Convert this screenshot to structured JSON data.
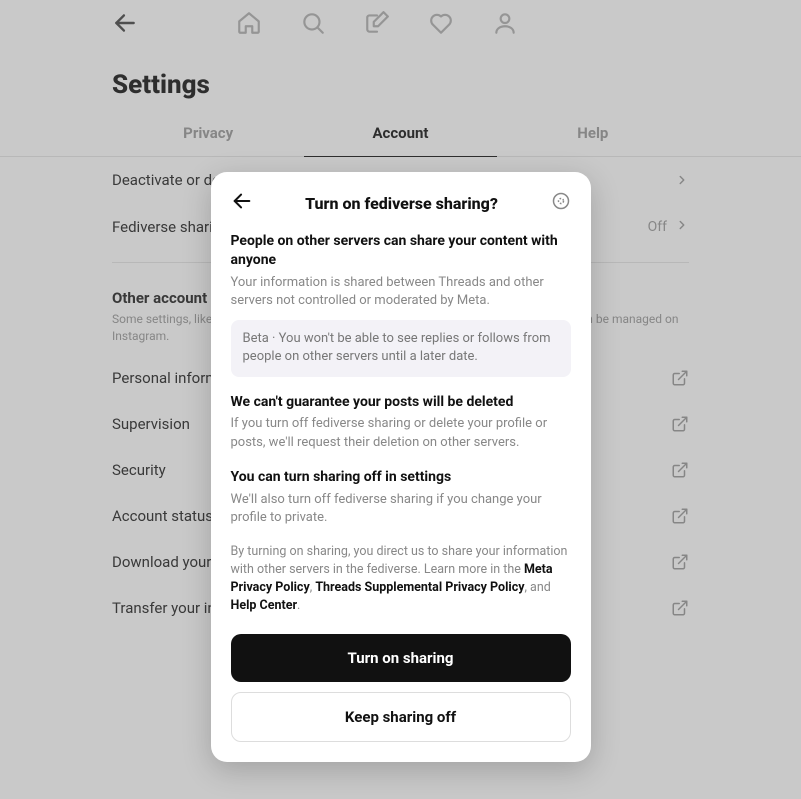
{
  "page": {
    "title": "Settings"
  },
  "tabs": {
    "privacy": "Privacy",
    "account": "Account",
    "help": "Help"
  },
  "settings": {
    "deactivate": "Deactivate or delete profile",
    "fediverse": "Fediverse sharing",
    "fediverse_value": "Off"
  },
  "section": {
    "title": "Other account settings",
    "desc": "Some settings, like username and password, apply to both Threads and Instagram and can be managed on Instagram."
  },
  "other_settings": {
    "personal": "Personal information",
    "supervision": "Supervision",
    "security": "Security",
    "account_status": "Account status",
    "download": "Download your information",
    "transfer": "Transfer your information"
  },
  "modal": {
    "title": "Turn on fediverse sharing?",
    "h1": "People on other servers can share your content with anyone",
    "t1": "Your information is shared between Threads and other servers not controlled or moderated by Meta.",
    "beta": "Beta · You won't be able to see replies or follows from people on other servers until a later date.",
    "h2": "We can't guarantee your posts will be deleted",
    "t2": "If you turn off fediverse sharing or delete your profile or posts, we'll request their deletion on other servers.",
    "h3": "You can turn sharing off in settings",
    "t3": "We'll also turn off fediverse sharing if you change your profile to private.",
    "disclaimer_prefix": "By turning on sharing, you direct us to share your information with other servers in the fediverse. Learn more in the ",
    "link1": "Meta Privacy Policy",
    "sep1": ", ",
    "link2": "Threads Supplemental Privacy Policy",
    "sep2": ", and ",
    "link3": "Help Center",
    "disclaimer_suffix": ".",
    "btn_primary": "Turn on sharing",
    "btn_secondary": "Keep sharing off"
  }
}
